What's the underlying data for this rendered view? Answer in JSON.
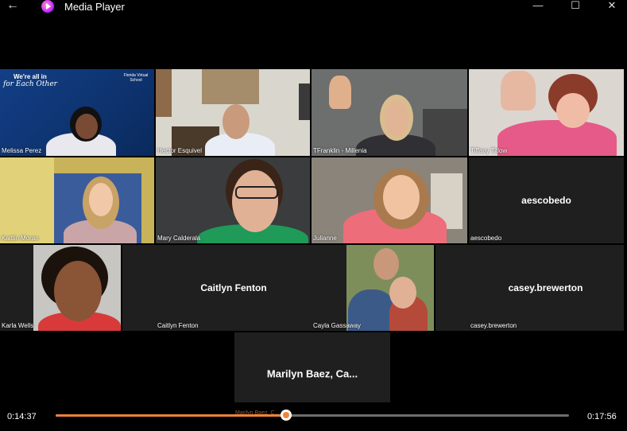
{
  "window": {
    "title": "Media Player",
    "back_glyph": "←",
    "minimize_glyph": "—",
    "maximize_glyph": "☐",
    "close_glyph": "✕"
  },
  "participants": [
    {
      "id": "melissa",
      "name": "Melissa Perez",
      "banner_line1": "We're all in",
      "banner_line2": "for Each Other",
      "school": "Florida Virtual School"
    },
    {
      "id": "hector",
      "name": "Hector Esquivel"
    },
    {
      "id": "tfranklin",
      "name": "TFranklin - Millenia"
    },
    {
      "id": "tiffany",
      "name": "Tiffany Titlow"
    },
    {
      "id": "kaitlin",
      "name": "Kaitlin Moran"
    },
    {
      "id": "mary",
      "name": "Mary Calderala"
    },
    {
      "id": "julianne",
      "name": "Julianne"
    },
    {
      "id": "aescobedo",
      "name": "aescobedo",
      "center": "aescobedo"
    },
    {
      "id": "karla",
      "name": "Karla Wells"
    },
    {
      "id": "caitlyn",
      "name": "Caitlyn Fenton",
      "center": "Caitlyn Fenton"
    },
    {
      "id": "cayla",
      "name": "Cayla Gassaway"
    },
    {
      "id": "casey",
      "name": "casey.brewerton",
      "center": "casey.brewerton"
    },
    {
      "id": "marilyn",
      "center": "Marilyn  Baez,  Ca..."
    }
  ],
  "playback": {
    "elapsed": "0:14:37",
    "total": "0:17:56",
    "progress": 0.449,
    "ghost_label": "Marilyn Baez, C..."
  },
  "colors": {
    "accent": "#f0833a",
    "tile_bg": "#1f1f1f"
  }
}
